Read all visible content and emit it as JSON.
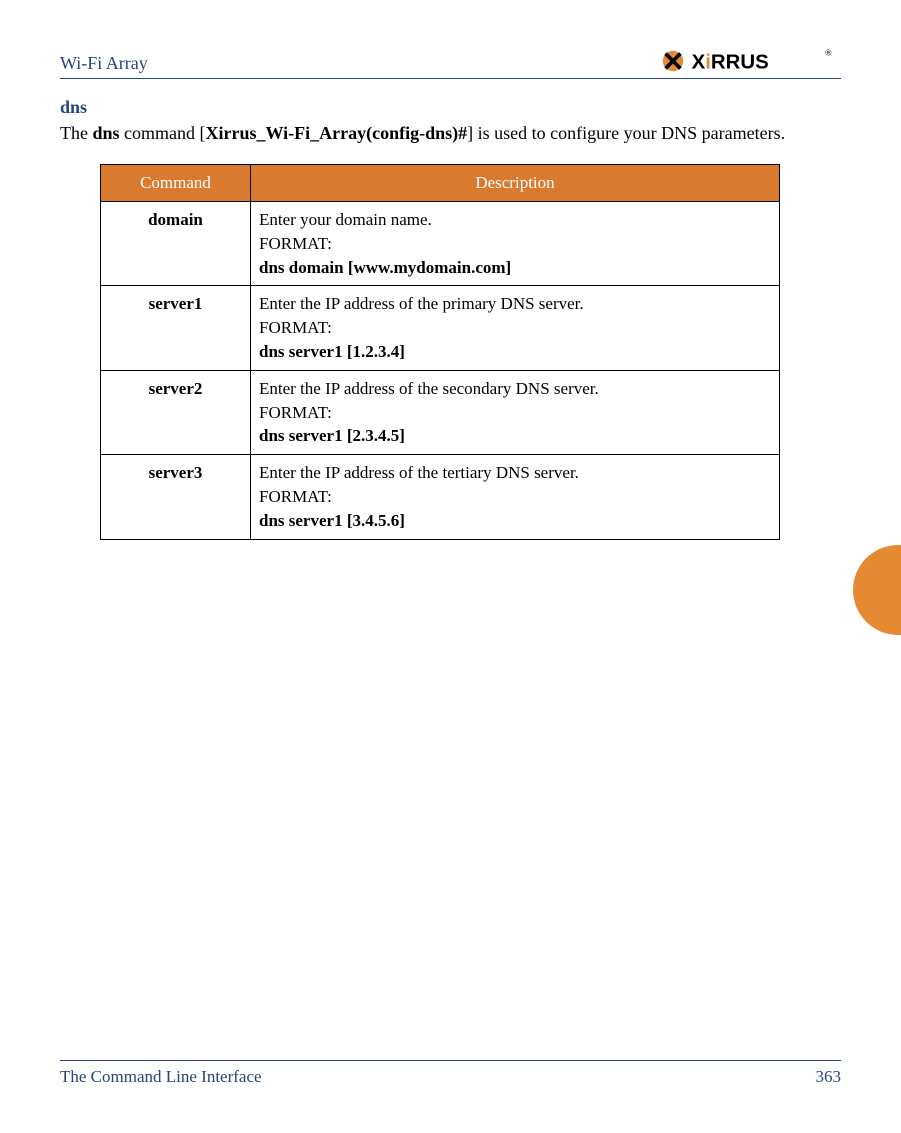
{
  "header": {
    "doc_title": "Wi-Fi Array",
    "logo_text": "XIRRUS"
  },
  "section": {
    "title": "dns",
    "intro_pre": "The ",
    "intro_bold1": "dns",
    "intro_mid": " command [",
    "intro_bold2": "Xirrus_Wi-Fi_Array(config-dns)#",
    "intro_post": "] is used to configure your DNS parameters."
  },
  "table": {
    "head_command": "Command",
    "head_description": "Description",
    "rows": [
      {
        "cmd": "domain",
        "l1": "Enter your domain name.",
        "l2": "FORMAT:",
        "l3": "dns domain [www.mydomain.com]"
      },
      {
        "cmd": "server1",
        "l1": "Enter the IP address of the primary DNS server.",
        "l2": "FORMAT:",
        "l3": "dns server1 [1.2.3.4]"
      },
      {
        "cmd": "server2",
        "l1": "Enter the IP address of the secondary DNS server.",
        "l2": "FORMAT:",
        "l3": "dns server1 [2.3.4.5]"
      },
      {
        "cmd": "server3",
        "l1": "Enter the IP address of the tertiary DNS server.",
        "l2": "FORMAT:",
        "l3": "dns server1 [3.4.5.6]"
      }
    ]
  },
  "footer": {
    "left": "The Command Line Interface",
    "right": "363"
  }
}
